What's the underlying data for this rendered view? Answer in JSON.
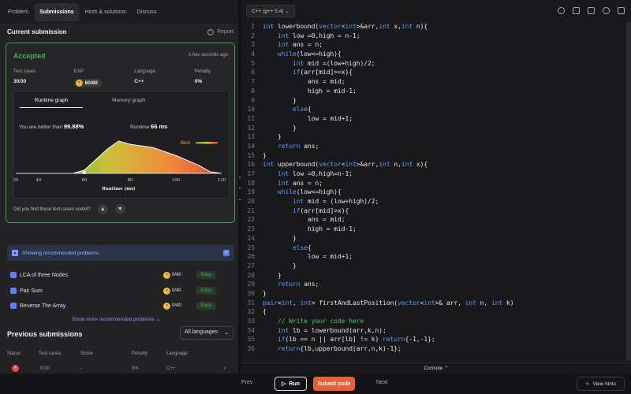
{
  "tabs": [
    "Problem",
    "Submissions",
    "Hints & solutions",
    "Discuss"
  ],
  "current": {
    "title": "Current submission",
    "report": "Report",
    "status": "Accepted",
    "time_ago": "A few seconds ago",
    "stats": [
      {
        "label": "Test cases",
        "value": "30/30"
      },
      {
        "label": "EXP",
        "value": "80/80"
      },
      {
        "label": "Language",
        "value": "C++"
      },
      {
        "label": "Penalty",
        "value": "0%"
      }
    ],
    "graph_tabs": [
      "Runtime graph",
      "Memory graph"
    ],
    "better_label": "You are better than",
    "better_value": "99.88%",
    "runtime_label": "Runtime",
    "runtime_value": "66 ms",
    "useful_q": "Did you find these test cases useful?"
  },
  "chart_data": {
    "type": "area",
    "xlabel": "Runtime (ms)",
    "x_ticks": [
      30,
      40,
      60,
      80,
      100,
      120
    ],
    "xlim": [
      30,
      120
    ],
    "points": [
      [
        30,
        0
      ],
      [
        55,
        0
      ],
      [
        60,
        0.1
      ],
      [
        70,
        0.75
      ],
      [
        75,
        1.0
      ],
      [
        80,
        0.9
      ],
      [
        90,
        0.8
      ],
      [
        100,
        0.55
      ],
      [
        110,
        0.25
      ],
      [
        115,
        0.05
      ],
      [
        120,
        0
      ]
    ],
    "legend": "Best",
    "marker_x": 60
  },
  "recommended": {
    "label": "Showing recommended problems",
    "items": [
      {
        "name": "LCA of three Nodes",
        "score": "0/40",
        "level": "Easy"
      },
      {
        "name": "Pair Sum",
        "score": "0/40",
        "level": "Easy"
      },
      {
        "name": "Reverse The Array",
        "score": "0/40",
        "level": "Easy"
      }
    ],
    "show_more": "Show more recommended problems"
  },
  "previous": {
    "title": "Previous submissions",
    "lang_filter": "All languages",
    "headers": [
      "Status",
      "Test cases",
      "Score",
      "Penalty",
      "Language"
    ],
    "row": {
      "test_cases": "0/30",
      "score": "-",
      "penalty": "0%",
      "language": "C++"
    }
  },
  "editor": {
    "language": "C++ (g++ 5.4)",
    "lines": [
      "int lowerbound(vector<int>&arr,int x,int n){",
      "    int low =0,high = n-1;",
      "    int ans = n;",
      "    while(low<=high){",
      "        int mid =(low+high)/2;",
      "        if(arr[mid]>=x){",
      "            ans = mid;",
      "            high = mid-1;",
      "        }",
      "        else{",
      "            low = mid+1;",
      "        }",
      "    }",
      "    return ans;",
      "}",
      "int upperbound(vector<int>&arr,int n,int x){",
      "    int low =0,high=n-1;",
      "    int ans = n;",
      "    while(low<=high){",
      "        int mid = (low+high)/2;",
      "        if(arr[mid]>x){",
      "            ans = mid;",
      "            high = mid-1;",
      "        }",
      "        else{",
      "            low = mid+1;",
      "        }",
      "    }",
      "    return ans;",
      "}",
      "pair<int, int> firstAndLastPosition(vector<int>& arr, int n, int k)",
      "{",
      "    // Write your code here",
      "    int lb = lowerbound(arr,k,n);",
      "    if(lb == n || arr[lb] != k) return{-1,-1};",
      "    return{lb,upperbound(arr,n,k)-1};"
    ],
    "console": "Console"
  },
  "footer": {
    "prev": "Prev",
    "run": "Run",
    "submit": "Submit code",
    "next": "Next",
    "hints": "View hints"
  }
}
